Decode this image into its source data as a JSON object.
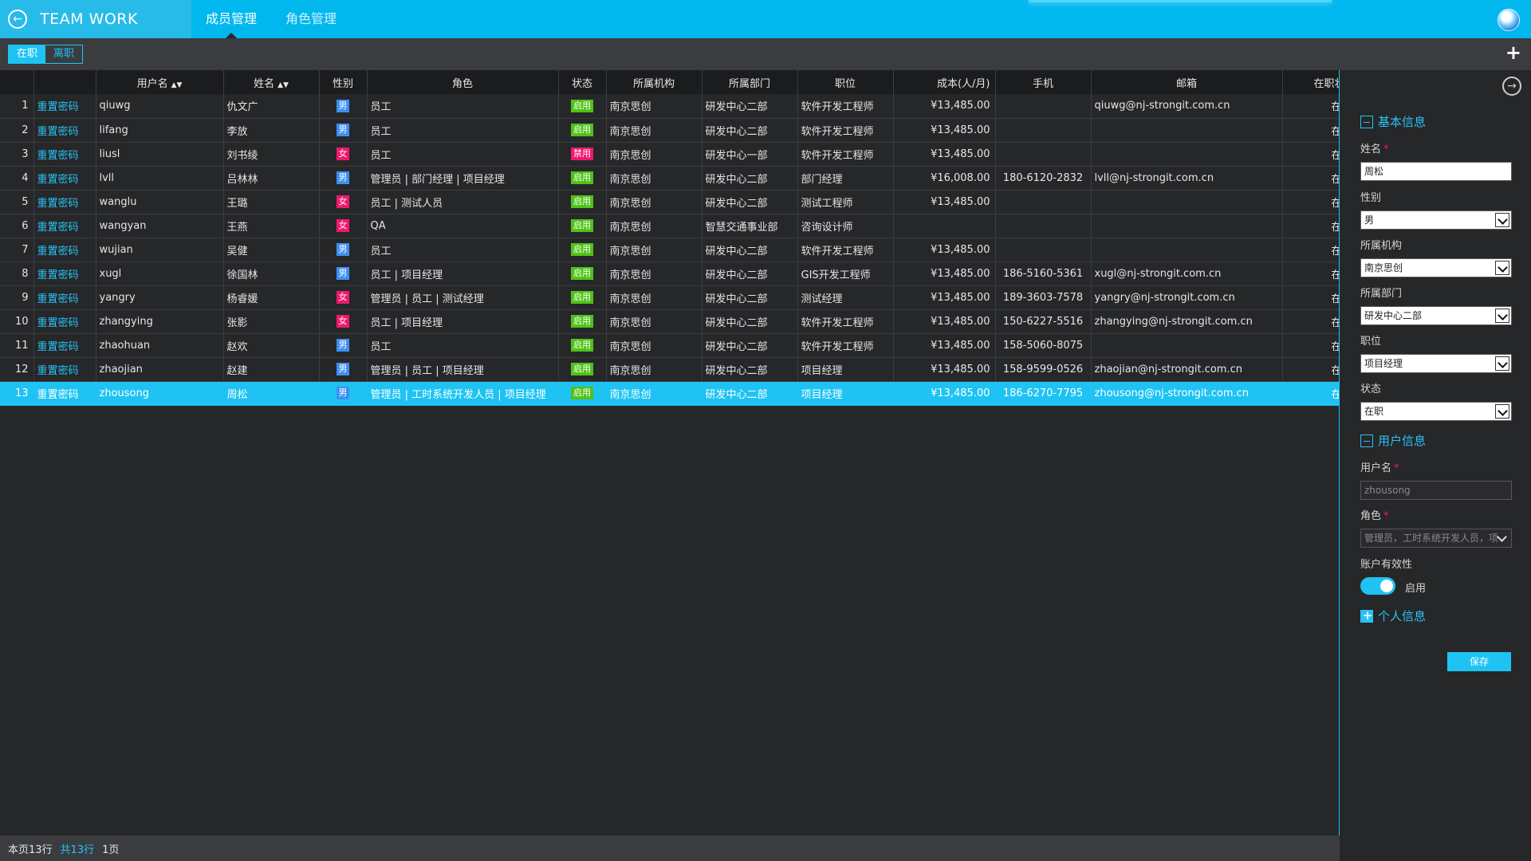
{
  "app": {
    "title": "TEAM WORK"
  },
  "nav": {
    "tabs": [
      "成员管理",
      "角色管理"
    ]
  },
  "filter": {
    "active_label": "在职",
    "inactive_label": "离职"
  },
  "table": {
    "headers": {
      "username": "用户名",
      "name": "姓名",
      "gender": "性别",
      "role": "角色",
      "status": "状态",
      "org": "所属机构",
      "dept": "所属部门",
      "position": "职位",
      "cost": "成本(人/月)",
      "phone": "手机",
      "email": "邮箱",
      "employ": "在职状态"
    },
    "reset_label": "重置密码",
    "rows": [
      {
        "num": "1",
        "username": "qiuwg",
        "name": "仇文广",
        "gender": "男",
        "role": "员工",
        "status": "启用",
        "org": "南京思创",
        "dept": "研发中心二部",
        "position": "软件开发工程师",
        "cost": "¥13,485.00",
        "phone": "",
        "email": "qiuwg@nj-strongit.com.cn",
        "employ": "在职"
      },
      {
        "num": "2",
        "username": "lifang",
        "name": "李放",
        "gender": "男",
        "role": "员工",
        "status": "启用",
        "org": "南京思创",
        "dept": "研发中心二部",
        "position": "软件开发工程师",
        "cost": "¥13,485.00",
        "phone": "",
        "email": "",
        "employ": "在职"
      },
      {
        "num": "3",
        "username": "liusl",
        "name": "刘书绫",
        "gender": "女",
        "role": "员工",
        "status": "禁用",
        "org": "南京思创",
        "dept": "研发中心一部",
        "position": "软件开发工程师",
        "cost": "¥13,485.00",
        "phone": "",
        "email": "",
        "employ": "在职"
      },
      {
        "num": "4",
        "username": "lvll",
        "name": "吕林林",
        "gender": "男",
        "role": "管理员 | 部门经理 | 项目经理",
        "status": "启用",
        "org": "南京思创",
        "dept": "研发中心二部",
        "position": "部门经理",
        "cost": "¥16,008.00",
        "phone": "180-6120-2832",
        "email": "lvll@nj-strongit.com.cn",
        "employ": "在职"
      },
      {
        "num": "5",
        "username": "wanglu",
        "name": "王璐",
        "gender": "女",
        "role": "员工 | 测试人员",
        "status": "启用",
        "org": "南京思创",
        "dept": "研发中心二部",
        "position": "测试工程师",
        "cost": "¥13,485.00",
        "phone": "",
        "email": "",
        "employ": "在职"
      },
      {
        "num": "6",
        "username": "wangyan",
        "name": "王燕",
        "gender": "女",
        "role": "QA",
        "status": "启用",
        "org": "南京思创",
        "dept": "智慧交通事业部",
        "position": "咨询设计师",
        "cost": "",
        "phone": "",
        "email": "",
        "employ": "在职"
      },
      {
        "num": "7",
        "username": "wujian",
        "name": "吴健",
        "gender": "男",
        "role": "员工",
        "status": "启用",
        "org": "南京思创",
        "dept": "研发中心二部",
        "position": "软件开发工程师",
        "cost": "¥13,485.00",
        "phone": "",
        "email": "",
        "employ": "在职"
      },
      {
        "num": "8",
        "username": "xugl",
        "name": "徐国林",
        "gender": "男",
        "role": "员工 | 项目经理",
        "status": "启用",
        "org": "南京思创",
        "dept": "研发中心二部",
        "position": "GIS开发工程师",
        "cost": "¥13,485.00",
        "phone": "186-5160-5361",
        "email": "xugl@nj-strongit.com.cn",
        "employ": "在职"
      },
      {
        "num": "9",
        "username": "yangry",
        "name": "杨睿媛",
        "gender": "女",
        "role": "管理员 | 员工 | 测试经理",
        "status": "启用",
        "org": "南京思创",
        "dept": "研发中心二部",
        "position": "测试经理",
        "cost": "¥13,485.00",
        "phone": "189-3603-7578",
        "email": "yangry@nj-strongit.com.cn",
        "employ": "在职"
      },
      {
        "num": "10",
        "username": "zhangying",
        "name": "张影",
        "gender": "女",
        "role": "员工 | 项目经理",
        "status": "启用",
        "org": "南京思创",
        "dept": "研发中心二部",
        "position": "软件开发工程师",
        "cost": "¥13,485.00",
        "phone": "150-6227-5516",
        "email": "zhangying@nj-strongit.com.cn",
        "employ": "在职"
      },
      {
        "num": "11",
        "username": "zhaohuan",
        "name": "赵欢",
        "gender": "男",
        "role": "员工",
        "status": "启用",
        "org": "南京思创",
        "dept": "研发中心二部",
        "position": "软件开发工程师",
        "cost": "¥13,485.00",
        "phone": "158-5060-8075",
        "email": "",
        "employ": "在职"
      },
      {
        "num": "12",
        "username": "zhaojian",
        "name": "赵建",
        "gender": "男",
        "role": "管理员 | 员工 | 项目经理",
        "status": "启用",
        "org": "南京思创",
        "dept": "研发中心二部",
        "position": "项目经理",
        "cost": "¥13,485.00",
        "phone": "158-9599-0526",
        "email": "zhaojian@nj-strongit.com.cn",
        "employ": "在职"
      },
      {
        "num": "13",
        "username": "zhousong",
        "name": "周松",
        "gender": "男",
        "role": "管理员 | 工时系统开发人员 | 项目经理",
        "status": "启用",
        "org": "南京思创",
        "dept": "研发中心二部",
        "position": "项目经理",
        "cost": "¥13,485.00",
        "phone": "186-6270-7795",
        "email": "zhousong@nj-strongit.com.cn",
        "employ": "在职"
      }
    ]
  },
  "footer": {
    "page_rows": "本页13行",
    "total_rows": "共13行",
    "pages": "1页"
  },
  "panel": {
    "basic_section": "基本信息",
    "name_label": "姓名",
    "name_value": "周松",
    "gender_label": "性别",
    "gender_value": "男",
    "org_label": "所属机构",
    "org_value": "南京思创",
    "dept_label": "所属部门",
    "dept_value": "研发中心二部",
    "position_label": "职位",
    "position_value": "项目经理",
    "status_label": "状态",
    "status_value": "在职",
    "user_section": "用户信息",
    "username_label": "用户名",
    "username_value": "zhousong",
    "role_label": "角色",
    "role_value": "管理员，工时系统开发人员，项",
    "validity_label": "账户有效性",
    "validity_value": "启用",
    "personal_section": "个人信息",
    "save_label": "保存",
    "required_mark": "*"
  },
  "colors": {
    "accent": "#1ec3f3",
    "male": "#3d8ff2",
    "female": "#f0186c",
    "enabled": "#4fc218",
    "disabled": "#f0186c"
  },
  "icons": {
    "back": "back-arrow-icon",
    "add": "plus-icon",
    "panel_nav": "arrow-right-circle-icon",
    "avatar": "globe-avatar-icon"
  }
}
